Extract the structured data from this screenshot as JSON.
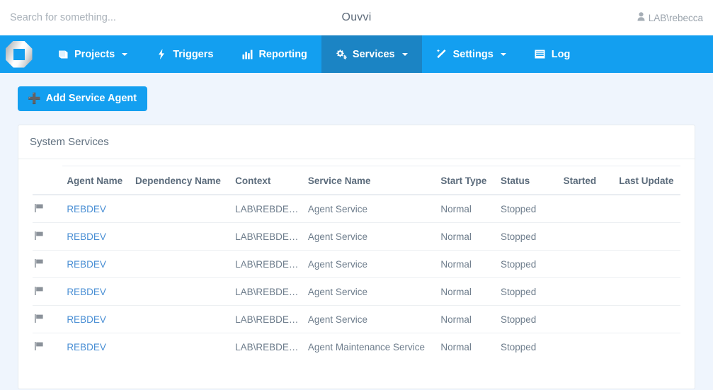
{
  "topbar": {
    "search_placeholder": "Search for something...",
    "search_value": "",
    "app_title": "Ouvvi",
    "user_name": "LAB\\rebecca",
    "user_icon": "user-icon"
  },
  "nav": {
    "brand_logo": "ouvvi-logo-icon",
    "items": [
      {
        "label": "Projects",
        "icon": "book-icon",
        "caret": true,
        "active": false
      },
      {
        "label": "Triggers",
        "icon": "bolt-icon",
        "caret": false,
        "active": false
      },
      {
        "label": "Reporting",
        "icon": "chart-icon",
        "caret": false,
        "active": false
      },
      {
        "label": "Services",
        "icon": "gears-icon",
        "caret": true,
        "active": true
      },
      {
        "label": "Settings",
        "icon": "wand-icon",
        "caret": true,
        "active": false
      },
      {
        "label": "Log",
        "icon": "list-icon",
        "caret": false,
        "active": false
      }
    ]
  },
  "toolbar": {
    "add_service_agent_label": "Add Service Agent",
    "add_icon": "plus-icon"
  },
  "panel": {
    "title": "System Services",
    "table": {
      "columns": [
        "",
        "Agent Name",
        "Dependency Name",
        "Context",
        "Service Name",
        "Start Type",
        "Status",
        "Started",
        "Last Update"
      ],
      "rows": [
        {
          "flag": "flag-icon",
          "agent_name": "REBDEV",
          "dependency_name": "",
          "context": "LAB\\REBDEV$",
          "service_name": "Agent Service",
          "start_type": "Normal",
          "status": "Stopped",
          "started": "",
          "last_update": ""
        },
        {
          "flag": "flag-icon",
          "agent_name": "REBDEV",
          "dependency_name": "",
          "context": "LAB\\REBDEV$",
          "service_name": "Agent Service",
          "start_type": "Normal",
          "status": "Stopped",
          "started": "",
          "last_update": ""
        },
        {
          "flag": "flag-icon",
          "agent_name": "REBDEV",
          "dependency_name": "",
          "context": "LAB\\REBDEV$",
          "service_name": "Agent Service",
          "start_type": "Normal",
          "status": "Stopped",
          "started": "",
          "last_update": ""
        },
        {
          "flag": "flag-icon",
          "agent_name": "REBDEV",
          "dependency_name": "",
          "context": "LAB\\REBDEV$",
          "service_name": "Agent Service",
          "start_type": "Normal",
          "status": "Stopped",
          "started": "",
          "last_update": ""
        },
        {
          "flag": "flag-icon",
          "agent_name": "REBDEV",
          "dependency_name": "",
          "context": "LAB\\REBDEV$",
          "service_name": "Agent Service",
          "start_type": "Normal",
          "status": "Stopped",
          "started": "",
          "last_update": ""
        },
        {
          "flag": "flag-icon",
          "agent_name": "REBDEV",
          "dependency_name": "",
          "context": "LAB\\REBDEV$",
          "service_name": "Agent Maintenance Service",
          "start_type": "Normal",
          "status": "Stopped",
          "started": "",
          "last_update": ""
        }
      ]
    }
  },
  "colors": {
    "nav_blue": "#139ff0",
    "nav_active_blue": "#1b84c4",
    "page_background": "#eff5fd",
    "panel_white": "#ffffff",
    "link_blue": "#4a8fd4",
    "text_gray": "#6e7d8c",
    "flag_gray": "#8a9199"
  }
}
